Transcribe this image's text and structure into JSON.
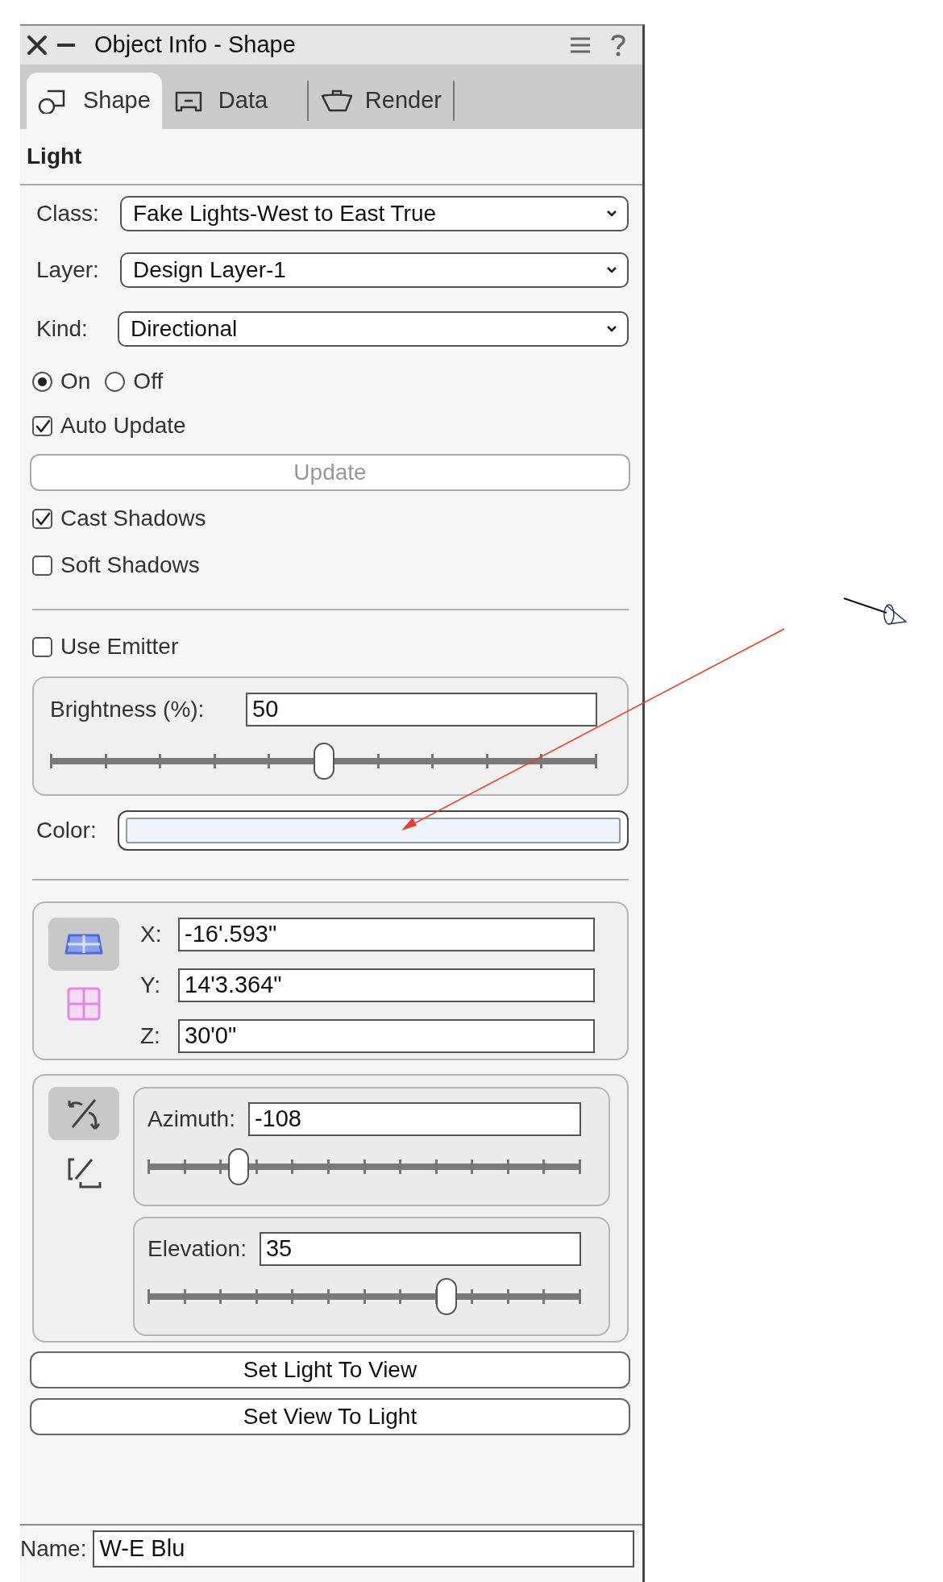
{
  "window": {
    "title": "Object Info - Shape"
  },
  "tabs": [
    {
      "label": "Shape",
      "kind": "shape",
      "selected": true
    },
    {
      "label": "Data",
      "kind": "data",
      "selected": false
    },
    {
      "label": "Render",
      "kind": "render",
      "selected": false
    }
  ],
  "section_title": "Light",
  "dropdowns": [
    {
      "label": "Class:",
      "value": "Fake Lights-West to East True"
    },
    {
      "label": "Layer:",
      "value": "Design Layer-1"
    },
    {
      "label": "Kind:",
      "value": "Directional"
    }
  ],
  "power": [
    {
      "label": "On",
      "selected": true
    },
    {
      "label": "Off",
      "selected": false
    }
  ],
  "auto_update": {
    "label": "Auto Update",
    "checked": true
  },
  "update_button": {
    "label": "Update",
    "disabled": true
  },
  "shadows": [
    {
      "label": "Cast Shadows",
      "checked": true
    },
    {
      "label": "Soft Shadows",
      "checked": false
    }
  ],
  "use_emitter": {
    "label": "Use Emitter",
    "checked": false
  },
  "brightness": {
    "label": "Brightness (%):",
    "value": "50",
    "level": 0.5
  },
  "color": {
    "label": "Color:",
    "color": "#eef4fc"
  },
  "position": {
    "modes": [
      {
        "kind": "plan",
        "selected": true
      },
      {
        "kind": "grid",
        "selected": false
      }
    ],
    "coords": [
      {
        "label": "X:",
        "value": "-16'.593\""
      },
      {
        "label": "Y:",
        "value": "14'3.364\""
      },
      {
        "label": "Z:",
        "value": "30'0\""
      }
    ]
  },
  "direction": {
    "modes": [
      {
        "kind": "rotate",
        "selected": true
      },
      {
        "kind": "aim",
        "selected": false
      }
    ],
    "angles": [
      {
        "label": "Azimuth:",
        "value": "-108",
        "level": 0.21
      },
      {
        "label": "Elevation:",
        "value": "35",
        "level": 0.69
      }
    ]
  },
  "buttons": [
    "Set Light To View",
    "Set View To Light"
  ],
  "name": {
    "label": "Name:",
    "value": "W-E Blu"
  }
}
